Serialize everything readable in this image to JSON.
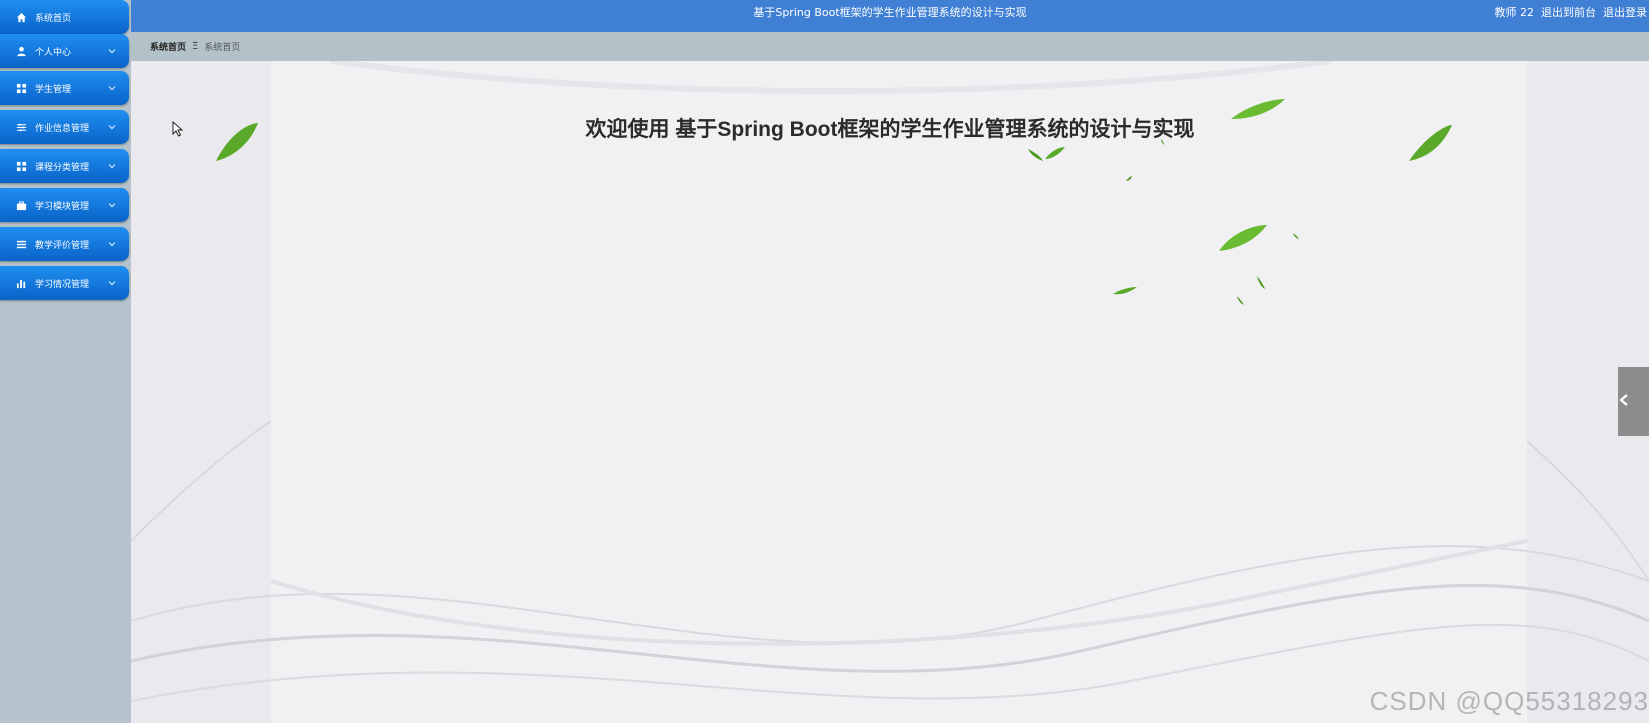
{
  "header": {
    "title": "基于Spring Boot框架的学生作业管理系统的设计与实现",
    "user_role": "教师 22",
    "back_to_front": "退出到前台",
    "logout": "退出登录"
  },
  "sidebar": {
    "items": [
      {
        "label": "系统首页",
        "icon": "home-icon"
      },
      {
        "label": "个人中心",
        "icon": "user-icon"
      },
      {
        "label": "学生管理",
        "icon": "grid-icon"
      },
      {
        "label": "作业信息管理",
        "icon": "sliders-icon"
      },
      {
        "label": "课程分类管理",
        "icon": "grid-icon"
      },
      {
        "label": "学习模块管理",
        "icon": "briefcase-icon"
      },
      {
        "label": "教学评价管理",
        "icon": "list-icon"
      },
      {
        "label": "学习情况管理",
        "icon": "bar-chart-icon"
      }
    ]
  },
  "breadcrumb": {
    "root": "系统首页",
    "separator": "Ξ",
    "current": "系统首页"
  },
  "main": {
    "welcome": "欢迎使用 基于Spring Boot框架的学生作业管理系统的设计与实现"
  },
  "watermark": "CSDN @QQ55318293",
  "colors": {
    "header_bg": "#3f7fd4",
    "nav_item_top": "#1f8ff0",
    "nav_item_bottom": "#0a63c9",
    "sidebar_bg": "#b5c4cc",
    "leaf_green": "#5aa92a"
  }
}
